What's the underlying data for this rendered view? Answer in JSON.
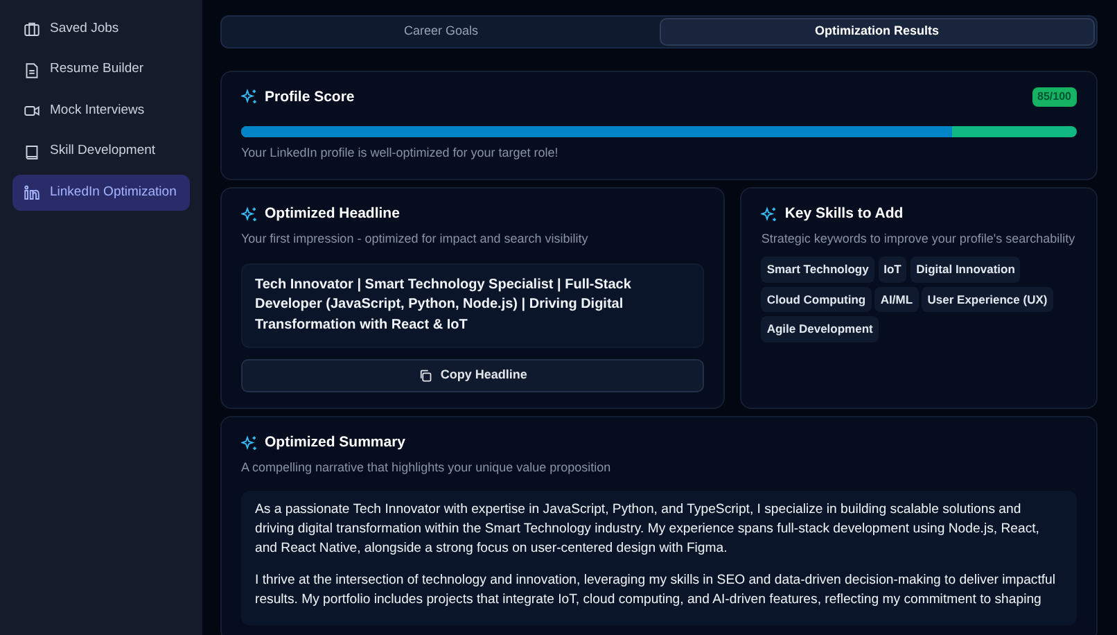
{
  "sidebar": {
    "items": [
      {
        "label": "Saved Jobs",
        "selected": false
      },
      {
        "label": "Resume Builder",
        "selected": false
      },
      {
        "label": "Mock Interviews",
        "selected": false
      },
      {
        "label": "Skill Development",
        "selected": false
      },
      {
        "label": "LinkedIn Optimization",
        "selected": true
      }
    ]
  },
  "tabs": [
    {
      "label": "Career Goals",
      "selected": false
    },
    {
      "label": "Optimization Results",
      "selected": true
    }
  ],
  "profile_score": {
    "title": "Profile Score",
    "badge": "85/100",
    "level": 0.85,
    "message": "Your LinkedIn profile is well-optimized for your target role!"
  },
  "headline": {
    "title": "Optimized Headline",
    "subtitle": "Your first impression - optimized for impact and search visibility",
    "text": "Tech Innovator | Smart Technology Specialist | Full-Stack Developer (JavaScript, Python, Node.js) | Driving Digital Transformation with React & IoT",
    "button": "Copy Headline"
  },
  "skills": {
    "title": "Key Skills to Add",
    "subtitle": "Strategic keywords to improve your profile's searchability",
    "tags": [
      "Smart Technology",
      "IoT",
      "Digital Innovation",
      "Cloud Computing",
      "AI/ML",
      "User Experience (UX)",
      "Agile Development"
    ]
  },
  "summary": {
    "title": "Optimized Summary",
    "subtitle": "A compelling narrative that highlights your unique value proposition",
    "paragraphs": [
      "As a passionate Tech Innovator with expertise in JavaScript, Python, and TypeScript, I specialize in building scalable solutions and driving digital transformation within the Smart Technology industry. My experience spans full-stack development using Node.js, React, and React Native, alongside a strong focus on user-centered design with Figma.",
      "I thrive at the intersection of technology and innovation, leveraging my skills in SEO and data-driven decision-making to deliver impactful results. My portfolio includes projects that integrate IoT, cloud computing, and AI-driven features, reflecting my commitment to shaping"
    ]
  }
}
